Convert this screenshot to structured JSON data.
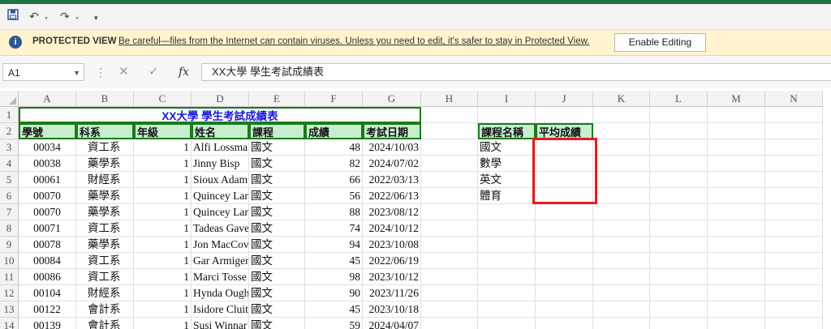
{
  "quick_access": {
    "save_icon": "save-icon",
    "undo_icon": "undo-icon",
    "redo_icon": "redo-icon",
    "customize_icon": "customize-qat-icon"
  },
  "protected_view": {
    "title": "PROTECTED VIEW",
    "message": "Be careful—files from the Internet can contain viruses. Unless you need to edit, it's safer to stay in Protected View.",
    "button": "Enable Editing",
    "bg_color": "#fff4ce"
  },
  "formula_bar": {
    "name_box": "A1",
    "fx": "fx",
    "content": "XX大學 學生考試成績表"
  },
  "columns": [
    "A",
    "B",
    "C",
    "D",
    "E",
    "F",
    "G",
    "H",
    "I",
    "J",
    "K",
    "L",
    "M",
    "N"
  ],
  "rows": [
    "1",
    "2",
    "3",
    "4",
    "5",
    "6",
    "7",
    "8",
    "9",
    "10",
    "11",
    "12",
    "13",
    "14"
  ],
  "sheet": {
    "title": "XX大學 學生考試成績表",
    "headers": [
      "學號",
      "科系",
      "年級",
      "姓名",
      "課程",
      "成績",
      "考試日期"
    ],
    "data": [
      [
        "00034",
        "資工系",
        "1",
        "Alfi Lossma",
        "國文",
        "48",
        "2024/10/03"
      ],
      [
        "00038",
        "藥學系",
        "1",
        "Jinny Bisp",
        "國文",
        "82",
        "2024/07/02"
      ],
      [
        "00061",
        "財經系",
        "1",
        "Sioux Adam",
        "國文",
        "66",
        "2022/03/13"
      ],
      [
        "00070",
        "藥學系",
        "1",
        "Quincey Lar",
        "國文",
        "56",
        "2022/06/13"
      ],
      [
        "00070",
        "藥學系",
        "1",
        "Quincey Lar",
        "國文",
        "88",
        "2023/08/12"
      ],
      [
        "00071",
        "資工系",
        "1",
        "Tadeas Gave",
        "國文",
        "74",
        "2024/10/12"
      ],
      [
        "00078",
        "藥學系",
        "1",
        "Jon MacCov",
        "國文",
        "94",
        "2023/10/08"
      ],
      [
        "00084",
        "資工系",
        "1",
        "Gar Armiger",
        "國文",
        "45",
        "2022/06/19"
      ],
      [
        "00086",
        "資工系",
        "1",
        "Marci Tosse",
        "國文",
        "98",
        "2023/10/12"
      ],
      [
        "00104",
        "財經系",
        "1",
        "Hynda Ough",
        "國文",
        "90",
        "2023/11/26"
      ],
      [
        "00122",
        "會計系",
        "1",
        "Isidore Cluit",
        "國文",
        "45",
        "2023/10/18"
      ],
      [
        "00139",
        "會計系",
        "1",
        "Susi Winnar",
        "國文",
        "59",
        "2024/04/07"
      ]
    ],
    "summary_headers": [
      "課程名稱",
      "平均成績"
    ],
    "courses": [
      "國文",
      "數學",
      "英文",
      "體育"
    ],
    "accent_green": "#1b7a1b",
    "header_fill": "#c6efce",
    "title_color": "#1a1ad6",
    "highlight_red": "#e51c23"
  }
}
